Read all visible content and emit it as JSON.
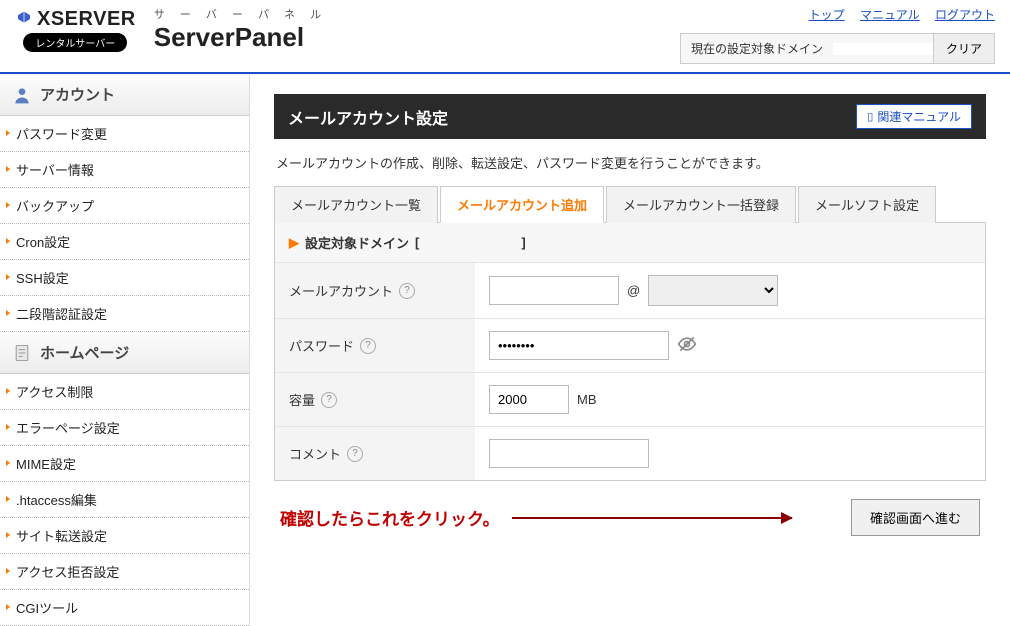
{
  "header": {
    "brand": "XSERVER",
    "rental_badge": "レンタルサーバー",
    "panel_kana": "サ ー バ ー パ ネ ル",
    "panel_name": "ServerPanel",
    "top_links": {
      "top": "トップ",
      "manual": "マニュアル",
      "logout": "ログアウト"
    },
    "domain_label": "現在の設定対象ドメイン",
    "domain_value": "",
    "clear_btn": "クリア"
  },
  "sidebar": {
    "section1": {
      "title": "アカウント",
      "items": [
        "パスワード変更",
        "サーバー情報",
        "バックアップ",
        "Cron設定",
        "SSH設定",
        "二段階認証設定"
      ]
    },
    "section2": {
      "title": "ホームページ",
      "items": [
        "アクセス制限",
        "エラーページ設定",
        "MIME設定",
        ".htaccess編集",
        "サイト転送設定",
        "アクセス拒否設定",
        "CGIツール"
      ]
    }
  },
  "page": {
    "title": "メールアカウント設定",
    "manual_btn": "関連マニュアル",
    "desc": "メールアカウントの作成、削除、転送設定、パスワード変更を行うことができます。",
    "tabs": [
      "メールアカウント一覧",
      "メールアカウント追加",
      "メールアカウント一括登録",
      "メールソフト設定"
    ],
    "active_tab": 1,
    "target_domain_label": "設定対象ドメイン",
    "target_domain_value": "",
    "form": {
      "account_label": "メールアカウント",
      "account_value": "",
      "at_symbol": "@",
      "domain_select_value": "",
      "password_label": "パスワード",
      "password_value": "••••••••",
      "capacity_label": "容量",
      "capacity_value": "2000",
      "capacity_unit": "MB",
      "comment_label": "コメント",
      "comment_value": ""
    },
    "annotation": "確認したらこれをクリック。",
    "submit_btn": "確認画面へ進む"
  }
}
